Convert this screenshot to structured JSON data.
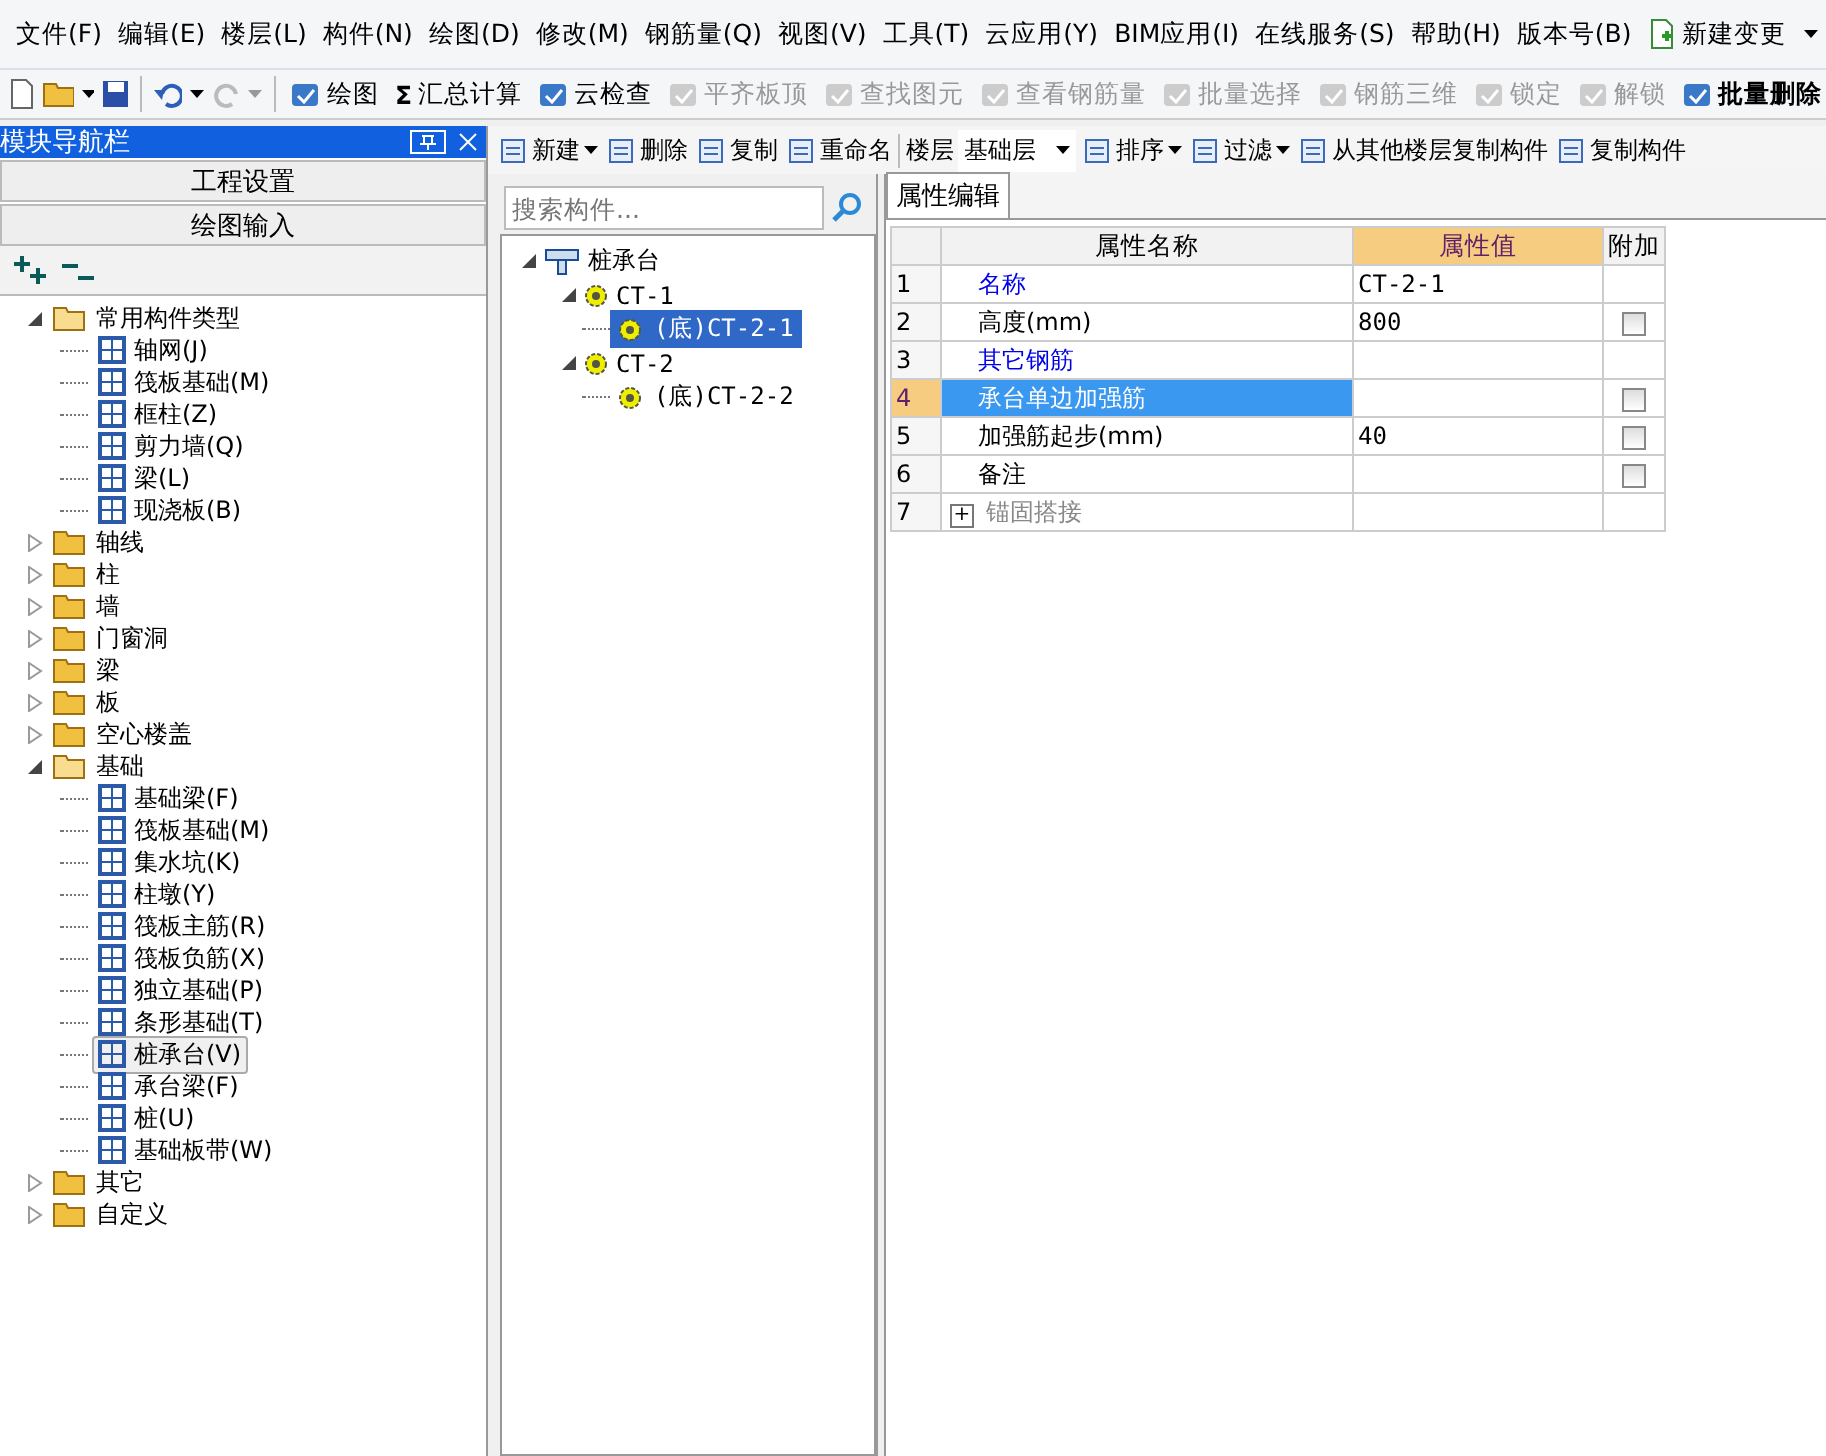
{
  "menu": [
    {
      "label": "文件(F)"
    },
    {
      "label": "编辑(E)"
    },
    {
      "label": "楼层(L)"
    },
    {
      "label": "构件(N)"
    },
    {
      "label": "绘图(D)"
    },
    {
      "label": "修改(M)"
    },
    {
      "label": "钢筋量(Q)"
    },
    {
      "label": "视图(V)"
    },
    {
      "label": "工具(T)"
    },
    {
      "label": "云应用(Y)"
    },
    {
      "label": "BIM应用(I)"
    },
    {
      "label": "在线服务(S)"
    },
    {
      "label": "帮助(H)"
    },
    {
      "label": "版本号(B)"
    },
    {
      "label": "新建变更",
      "dropdown": true
    }
  ],
  "toolbar": [
    {
      "label": "绘图",
      "disabled": false
    },
    {
      "label": "汇总计算",
      "symbol": "Σ",
      "disabled": false
    },
    {
      "label": "云检查",
      "disabled": false
    },
    {
      "label": "平齐板顶",
      "disabled": true
    },
    {
      "label": "查找图元",
      "disabled": true
    },
    {
      "label": "查看钢筋量",
      "disabled": true
    },
    {
      "label": "批量选择",
      "disabled": true
    },
    {
      "label": "钢筋三维",
      "disabled": true
    },
    {
      "label": "锁定",
      "disabled": true
    },
    {
      "label": "解锁",
      "disabled": true
    },
    {
      "label": "批量删除",
      "disabled": false,
      "bold": true
    }
  ],
  "nav": {
    "title": "模块导航栏",
    "sections": [
      "工程设置",
      "绘图输入"
    ],
    "tree": [
      {
        "label": "常用构件类型",
        "expanded": true,
        "children": [
          {
            "label": "轴网(J)",
            "selected": false
          },
          {
            "label": "筏板基础(M)",
            "selected": false
          },
          {
            "label": "框柱(Z)",
            "selected": false
          },
          {
            "label": "剪力墙(Q)",
            "selected": false
          },
          {
            "label": "梁(L)",
            "selected": false
          },
          {
            "label": "现浇板(B)",
            "selected": false
          }
        ]
      },
      {
        "label": "轴线",
        "expanded": false
      },
      {
        "label": "柱",
        "expanded": false
      },
      {
        "label": "墙",
        "expanded": false
      },
      {
        "label": "门窗洞",
        "expanded": false
      },
      {
        "label": "梁",
        "expanded": false
      },
      {
        "label": "板",
        "expanded": false
      },
      {
        "label": "空心楼盖",
        "expanded": false
      },
      {
        "label": "基础",
        "expanded": true,
        "children": [
          {
            "label": "基础梁(F)",
            "selected": false
          },
          {
            "label": "筏板基础(M)",
            "selected": false
          },
          {
            "label": "集水坑(K)",
            "selected": false
          },
          {
            "label": "柱墩(Y)",
            "selected": false
          },
          {
            "label": "筏板主筋(R)",
            "selected": false
          },
          {
            "label": "筏板负筋(X)",
            "selected": false
          },
          {
            "label": "独立基础(P)",
            "selected": false
          },
          {
            "label": "条形基础(T)",
            "selected": false
          },
          {
            "label": "桩承台(V)",
            "selected": true
          },
          {
            "label": "承台梁(F)",
            "selected": false
          },
          {
            "label": "桩(U)",
            "selected": false
          },
          {
            "label": "基础板带(W)",
            "selected": false
          }
        ]
      },
      {
        "label": "其它",
        "expanded": false
      },
      {
        "label": "自定义",
        "expanded": false
      }
    ]
  },
  "component_toolbar": [
    {
      "kind": "button",
      "label": "新建",
      "dropdown": true
    },
    {
      "kind": "button",
      "label": "删除"
    },
    {
      "kind": "button",
      "label": "复制"
    },
    {
      "kind": "button",
      "label": "重命名"
    },
    {
      "kind": "label",
      "label": "楼层"
    },
    {
      "kind": "select",
      "label": "基础层"
    },
    {
      "kind": "button",
      "label": "排序",
      "dropdown": true
    },
    {
      "kind": "button",
      "label": "过滤",
      "dropdown": true
    },
    {
      "kind": "button",
      "label": "从其他楼层复制构件"
    },
    {
      "kind": "button",
      "label": "复制构件"
    }
  ],
  "search": {
    "placeholder": "搜索构件..."
  },
  "component_tree": [
    {
      "label": "桩承台",
      "expanded": true,
      "children": [
        {
          "label": "CT-1",
          "expanded": true,
          "children": [
            {
              "label": "(底)CT-2-1",
              "selected": true
            }
          ]
        },
        {
          "label": "CT-2",
          "expanded": true,
          "children": [
            {
              "label": "(底)CT-2-2",
              "selected": false
            }
          ]
        }
      ]
    }
  ],
  "properties": {
    "tab": "属性编辑",
    "columns": [
      "属性名称",
      "属性值",
      "附加"
    ],
    "rows": [
      {
        "index": "1",
        "name": "名称",
        "value": "CT-2-1",
        "kind": "title",
        "selected": false
      },
      {
        "index": "2",
        "name": "高度(mm)",
        "value": "800",
        "kind": "normal",
        "selected": false,
        "checked": false
      },
      {
        "index": "3",
        "name": "其它钢筋",
        "kind": "title",
        "selected": false
      },
      {
        "index": "4",
        "name": "承台单边加强筋",
        "kind": "normal",
        "selected": true,
        "checked": false
      },
      {
        "index": "5",
        "name": "加强筋起步(mm)",
        "value": "40",
        "kind": "normal",
        "selected": false,
        "checked": false
      },
      {
        "index": "6",
        "name": "备注",
        "kind": "normal",
        "selected": false,
        "checked": false
      },
      {
        "index": "7",
        "name": "锚固搭接",
        "kind": "collapsed",
        "selected": false,
        "expand_sign": "+"
      }
    ]
  }
}
